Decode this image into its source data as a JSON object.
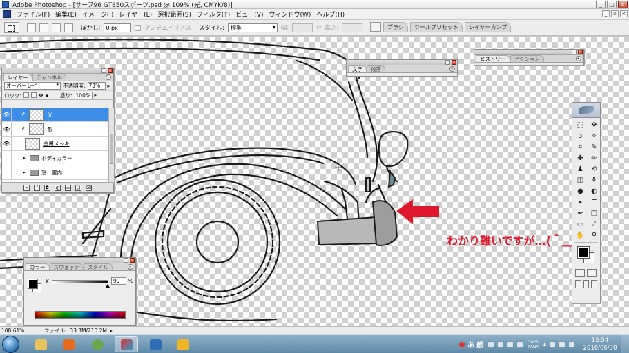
{
  "window": {
    "title": "Adobe Photoshop - [サーブ96 GT850スポーツ.psd @ 109% (光, CMYK/8)]",
    "buttons": [
      "_",
      "□",
      "×"
    ]
  },
  "menu": {
    "items": [
      "ファイル(F)",
      "編集(E)",
      "イメージ(I)",
      "レイヤー(L)",
      "選択範囲(S)",
      "フィルタ(T)",
      "ビュー(V)",
      "ウィンドウ(W)",
      "ヘルプ(H)"
    ]
  },
  "options": {
    "feather_label": "ぼかし:",
    "feather_value": "0 px",
    "antialias_label": "アンチエイリアス",
    "style_label": "スタイル:",
    "style_value": "標準",
    "width_label": "幅:",
    "height_label": "高さ:",
    "well_tabs": [
      "ブラシ",
      "ツールプリセット",
      "レイヤーカンプ"
    ]
  },
  "layers_palette": {
    "tabs": [
      "レイヤー",
      "チャンネル"
    ],
    "blend_mode": "オーバーレイ",
    "opacity_label": "不透明度:",
    "opacity_value": "73%",
    "lock_label": "ロック:",
    "fill_label": "塗り:",
    "fill_value": "100%",
    "layers": [
      {
        "name": "光",
        "type": "layer",
        "visible": true,
        "selected": true,
        "clipped": true
      },
      {
        "name": "影",
        "type": "layer",
        "visible": true,
        "selected": false,
        "clipped": true
      },
      {
        "name": "金属メッキ",
        "type": "layer",
        "visible": true,
        "selected": false,
        "clipped": false
      },
      {
        "name": "ボディカラー",
        "type": "group",
        "visible": false,
        "selected": false
      },
      {
        "name": "窓、室内",
        "type": "group",
        "visible": false,
        "selected": false
      }
    ]
  },
  "text_palette": {
    "tabs": [
      "文字",
      "段落"
    ]
  },
  "history_palette": {
    "tabs": [
      "ヒストリー",
      "アクション"
    ]
  },
  "color_palette": {
    "tabs": [
      "カラー",
      "スウォッチ",
      "スタイル"
    ],
    "channel_label": "K",
    "k_value": "99",
    "k_level": 0.99,
    "unit": "%",
    "foreground": "#000000",
    "background": "#ffffff"
  },
  "tools": {
    "icons": [
      "marquee-icon",
      "move-icon",
      "lasso-icon",
      "magic-wand-icon",
      "crop-icon",
      "slice-icon",
      "healing-icon",
      "brush-icon",
      "stamp-icon",
      "history-brush-icon",
      "eraser-icon",
      "bucket-icon",
      "blur-icon",
      "dodge-icon",
      "path-select-icon",
      "type-icon",
      "pen-icon",
      "shape-icon",
      "notes-icon",
      "eyedropper-icon",
      "hand-icon",
      "zoom-icon"
    ],
    "glyphs": [
      "⬚",
      "✥",
      "ↄ",
      "✧",
      "⌗",
      "✎",
      "✚",
      "✏",
      "♟",
      "⟲",
      "◫",
      "⚱",
      "●",
      "◐",
      "▸",
      "T",
      "✒",
      "□",
      "▭",
      "⁄",
      "✋",
      "⚲"
    ]
  },
  "canvas": {
    "annotation": "わかり難いですが…(＾＿＾;)",
    "annotation_color": "#e0182b"
  },
  "status": {
    "zoom": "108.61%",
    "file_info": "ファイル : 33.3M/210.2M"
  },
  "taskbar": {
    "ime": [
      "あ",
      "般"
    ],
    "caps": [
      "CAPS",
      "KANA"
    ],
    "time": "13:54",
    "date": "2016/06/30"
  }
}
